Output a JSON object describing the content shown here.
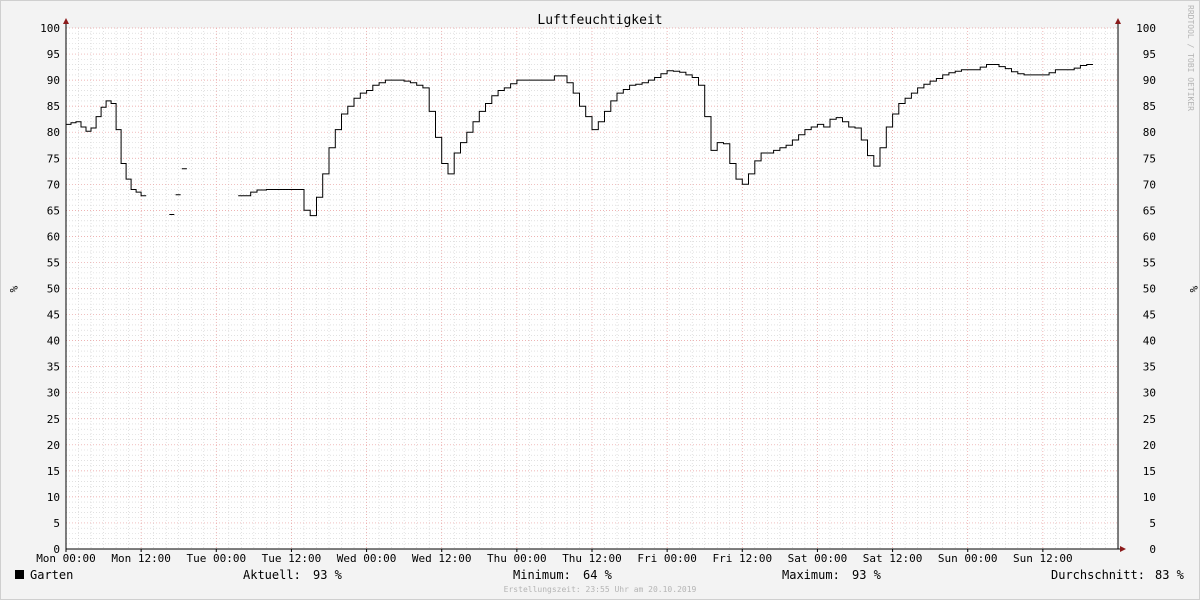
{
  "chart_data": {
    "type": "line",
    "title": "Luftfeuchtigkeit",
    "ylabel": "%",
    "ylim": [
      0,
      100
    ],
    "y_ticks": [
      "0",
      "5",
      "10",
      "15",
      "20",
      "25",
      "30",
      "35",
      "40",
      "45",
      "50",
      "55",
      "60",
      "65",
      "70",
      "75",
      "80",
      "85",
      "90",
      "95",
      "100"
    ],
    "x_ticks": [
      "Mon 00:00",
      "Mon 12:00",
      "Tue 00:00",
      "Tue 12:00",
      "Wed 00:00",
      "Wed 12:00",
      "Thu 00:00",
      "Thu 12:00",
      "Fri 00:00",
      "Fri 12:00",
      "Sat 00:00",
      "Sat 12:00",
      "Sun 00:00",
      "Sun 12:00"
    ],
    "x_range_hours": [
      0,
      168
    ],
    "grid": true,
    "series": [
      {
        "name": "Garten",
        "color": "#000000",
        "step": true,
        "points": [
          [
            0,
            81.5
          ],
          [
            0.8,
            81.8
          ],
          [
            1.6,
            82
          ],
          [
            2.4,
            81
          ],
          [
            3.2,
            80.2
          ],
          [
            4.0,
            80.8
          ],
          [
            4.8,
            83
          ],
          [
            5.6,
            84.8
          ],
          [
            6.4,
            86
          ],
          [
            7.2,
            85.5
          ],
          [
            8.0,
            80.5
          ],
          [
            8.8,
            74
          ],
          [
            9.6,
            71
          ],
          [
            10.4,
            69
          ],
          [
            11.2,
            68.5
          ],
          [
            12.0,
            67.8
          ],
          [
            12.8,
            null
          ],
          [
            16.5,
            64.2
          ],
          [
            17.3,
            null
          ],
          [
            17.5,
            68
          ],
          [
            18.3,
            null
          ],
          [
            18.5,
            73
          ],
          [
            19.3,
            null
          ],
          [
            27.5,
            67.8
          ],
          [
            28.5,
            67.8
          ],
          [
            29.5,
            68.5
          ],
          [
            30.5,
            68.9
          ],
          [
            32.0,
            69
          ],
          [
            34.0,
            69
          ],
          [
            36.0,
            69
          ],
          [
            37.0,
            69
          ],
          [
            38.0,
            65
          ],
          [
            39.0,
            64
          ],
          [
            40.0,
            67.5
          ],
          [
            41.0,
            72
          ],
          [
            42.0,
            77
          ],
          [
            43.0,
            80.5
          ],
          [
            44.0,
            83.5
          ],
          [
            45.0,
            85
          ],
          [
            46.0,
            86.5
          ],
          [
            47.0,
            87.5
          ],
          [
            48.0,
            88
          ],
          [
            49.0,
            89
          ],
          [
            50.0,
            89.5
          ],
          [
            51.0,
            90
          ],
          [
            52.0,
            90
          ],
          [
            53.0,
            90
          ],
          [
            54.0,
            89.8
          ],
          [
            55.0,
            89.5
          ],
          [
            56.0,
            89
          ],
          [
            57.0,
            88.5
          ],
          [
            58.0,
            84
          ],
          [
            59.0,
            79
          ],
          [
            60.0,
            74
          ],
          [
            61.0,
            72
          ],
          [
            62.0,
            76
          ],
          [
            63.0,
            78
          ],
          [
            64.0,
            80
          ],
          [
            65.0,
            82
          ],
          [
            66.0,
            84
          ],
          [
            67.0,
            85.5
          ],
          [
            68.0,
            87
          ],
          [
            69.0,
            88
          ],
          [
            70.0,
            88.5
          ],
          [
            71.0,
            89.3
          ],
          [
            72.0,
            90
          ],
          [
            73.0,
            90
          ],
          [
            74.0,
            90
          ],
          [
            75.0,
            90
          ],
          [
            76.0,
            90
          ],
          [
            77.0,
            90
          ],
          [
            78.0,
            90.8
          ],
          [
            79.0,
            90.8
          ],
          [
            80.0,
            89.5
          ],
          [
            81.0,
            87.5
          ],
          [
            82.0,
            85
          ],
          [
            83.0,
            83
          ],
          [
            84.0,
            80.5
          ],
          [
            85.0,
            82
          ],
          [
            86.0,
            84
          ],
          [
            87.0,
            86
          ],
          [
            88.0,
            87.5
          ],
          [
            89.0,
            88.2
          ],
          [
            90.0,
            89
          ],
          [
            91.0,
            89.2
          ],
          [
            92.0,
            89.5
          ],
          [
            93.0,
            90
          ],
          [
            94.0,
            90.5
          ],
          [
            95.0,
            91.2
          ],
          [
            96.0,
            91.8
          ],
          [
            97.0,
            91.7
          ],
          [
            98.0,
            91.5
          ],
          [
            99.0,
            91
          ],
          [
            100.0,
            90.5
          ],
          [
            101.0,
            89
          ],
          [
            102.0,
            83
          ],
          [
            103.0,
            76.5
          ],
          [
            104.0,
            78
          ],
          [
            105.0,
            77.8
          ],
          [
            106.0,
            74
          ],
          [
            107.0,
            71
          ],
          [
            108.0,
            70
          ],
          [
            109.0,
            72
          ],
          [
            110.0,
            74.5
          ],
          [
            111.0,
            76
          ],
          [
            112.0,
            76
          ],
          [
            113.0,
            76.5
          ],
          [
            114.0,
            77
          ],
          [
            115.0,
            77.5
          ],
          [
            116.0,
            78.5
          ],
          [
            117.0,
            79.5
          ],
          [
            118.0,
            80.5
          ],
          [
            119.0,
            81
          ],
          [
            120.0,
            81.5
          ],
          [
            121.0,
            81
          ],
          [
            122.0,
            82.5
          ],
          [
            123.0,
            82.8
          ],
          [
            124.0,
            82
          ],
          [
            125.0,
            81
          ],
          [
            126.0,
            80.8
          ],
          [
            127.0,
            78.5
          ],
          [
            128.0,
            75.5
          ],
          [
            129.0,
            73.5
          ],
          [
            130.0,
            77
          ],
          [
            131.0,
            81
          ],
          [
            132.0,
            83.5
          ],
          [
            133.0,
            85.5
          ],
          [
            134.0,
            86.5
          ],
          [
            135.0,
            87.5
          ],
          [
            136.0,
            88.5
          ],
          [
            137.0,
            89.2
          ],
          [
            138.0,
            89.8
          ],
          [
            139.0,
            90.3
          ],
          [
            140.0,
            91
          ],
          [
            141.0,
            91.4
          ],
          [
            142.0,
            91.7
          ],
          [
            143.0,
            92
          ],
          [
            144.0,
            92
          ],
          [
            145.0,
            92
          ],
          [
            146.0,
            92.5
          ],
          [
            147.0,
            93
          ],
          [
            148.0,
            93
          ],
          [
            149.0,
            92.6
          ],
          [
            150.0,
            92.2
          ],
          [
            151.0,
            91.6
          ],
          [
            152.0,
            91.2
          ],
          [
            153.0,
            91
          ],
          [
            154.0,
            91
          ],
          [
            155.0,
            91
          ],
          [
            156.0,
            91
          ],
          [
            157.0,
            91.4
          ],
          [
            158.0,
            92
          ],
          [
            159.0,
            92
          ],
          [
            160.0,
            92
          ],
          [
            161.0,
            92.3
          ],
          [
            162.0,
            92.8
          ],
          [
            163.0,
            93
          ],
          [
            164.0,
            93
          ]
        ]
      }
    ]
  },
  "legend": {
    "series_name": "Garten",
    "aktuell_label": "Aktuell:",
    "aktuell_value": "93 %",
    "minimum_label": "Minimum:",
    "minimum_value": "64 %",
    "maximum_label": "Maximum:",
    "maximum_value": "93 %",
    "durchschnitt_label": "Durchschnitt:",
    "durchschnitt_value": "83 %"
  },
  "watermark": "RRDTOOL / TOBI OETIKER",
  "footer": "Erstellungszeit: 23:55 Uhr am 20.10.2019",
  "colors": {
    "background": "#f3f3f3",
    "plot_background": "#ffffff",
    "major_grid": "#e89a9a",
    "minor_grid": "#cfcfcf",
    "axis": "#000000",
    "arrow": "#8b1a1a",
    "line": "#000000"
  }
}
